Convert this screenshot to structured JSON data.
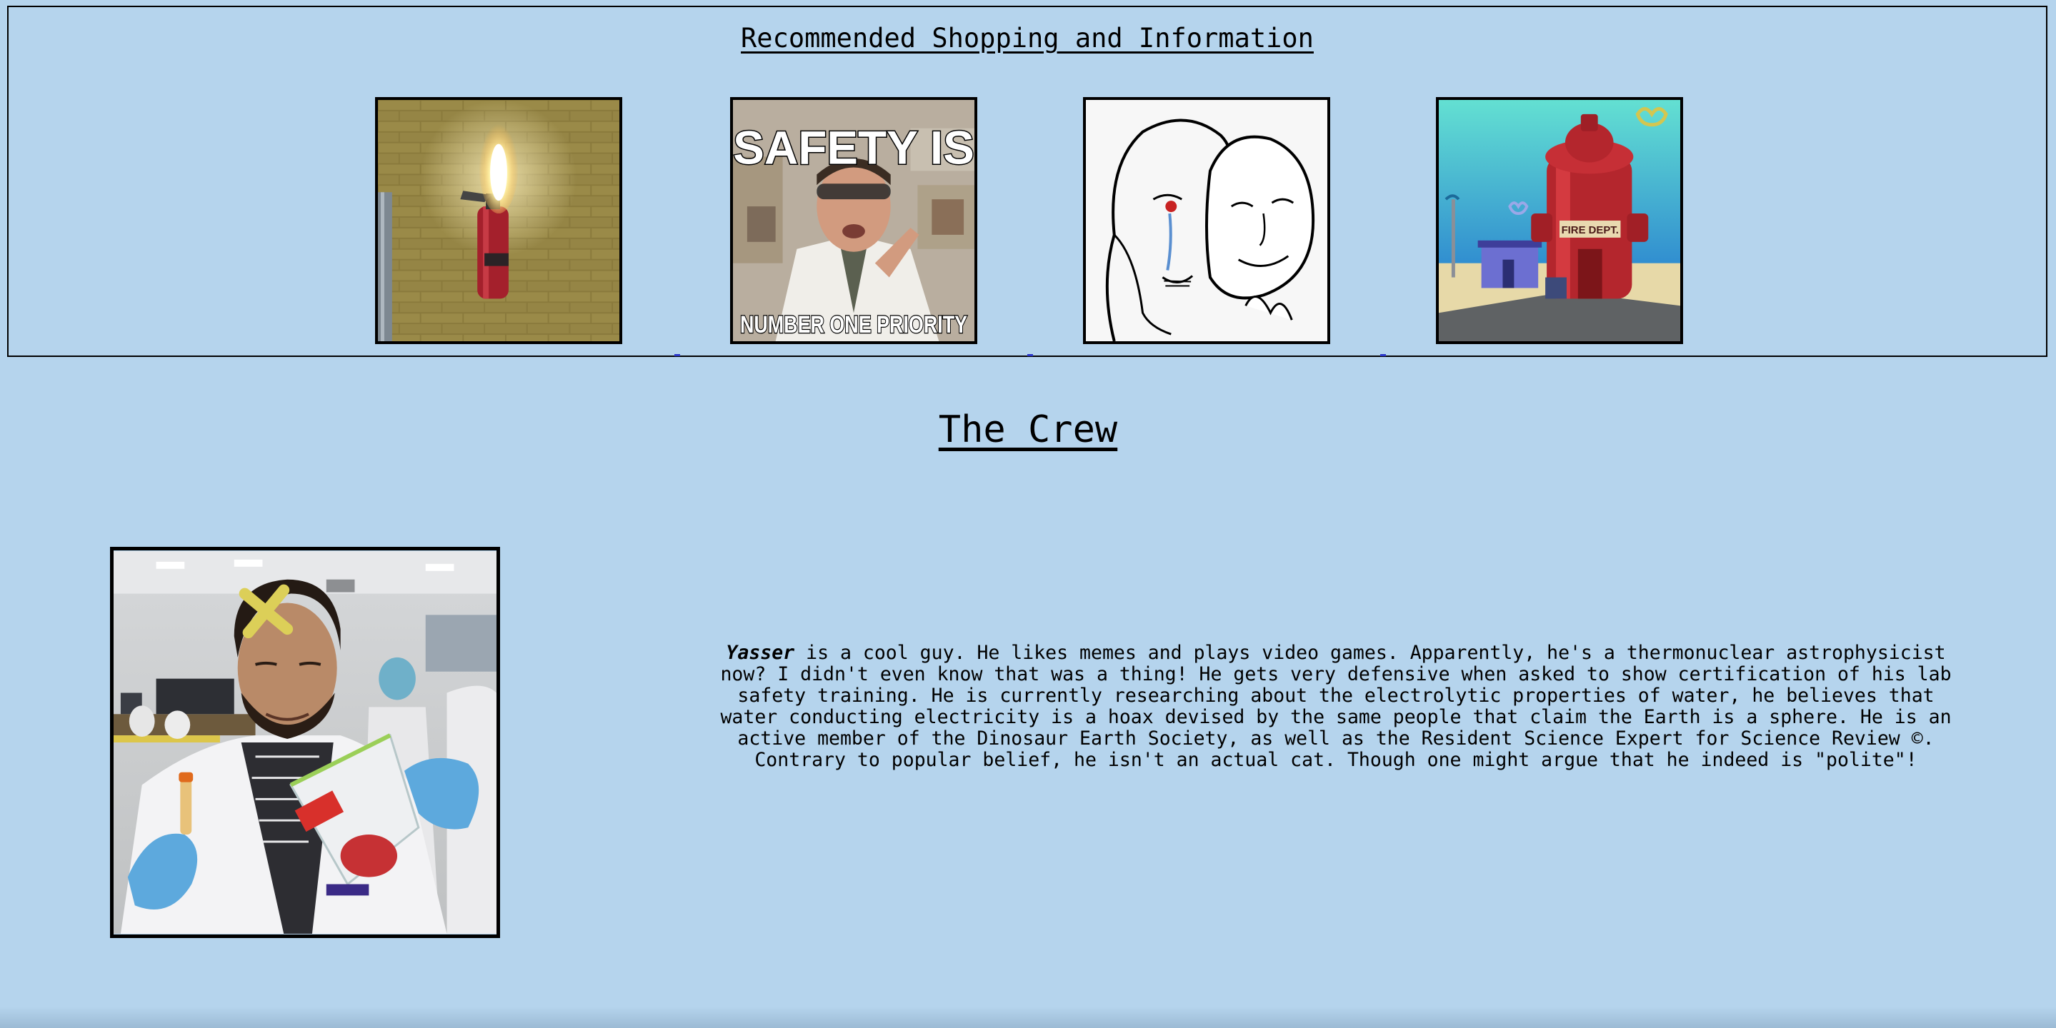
{
  "shop": {
    "title": "Recommended Shopping and Information",
    "items": [
      {
        "icon": "burning-fire-extinguisher-image"
      },
      {
        "icon": "safety-meme-image",
        "caption_top": "SAFETY IS",
        "caption_bottom": "NUMBER ONE PRIORITY"
      },
      {
        "icon": "wojak-mask-meme-image"
      },
      {
        "icon": "fire-hydrant-building-image",
        "sign": "FIRE DEPT."
      }
    ]
  },
  "crew": {
    "title": "The Crew",
    "members": [
      {
        "name": "Yasser",
        "bio": " is a cool guy. He likes memes and plays video games. Apparently, he's a thermonuclear astrophysicist now? I didn't even know that was a thing! He gets very defensive when asked to show certification of his lab safety training. He is currently researching about the electrolytic properties of water, he believes that water conducting electricity is a hoax devised by the same people that claim the Earth is a sphere. He is an active member of the Dinosaur Earth Society, as well as the Resident Science Expert for Science Review ©. Contrary to popular belief, he isn't an actual cat. Though one might argue that he indeed is \"polite\"!"
      }
    ]
  },
  "colors": {
    "background": "#b5d4ed",
    "border": "#000000",
    "link": "#2b36c9"
  }
}
